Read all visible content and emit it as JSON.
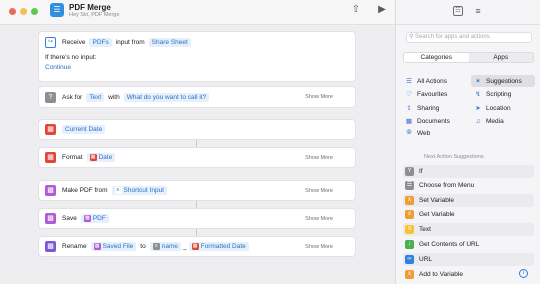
{
  "window": {
    "title": "PDF Merge",
    "subtitle": "Hey Siri, PDF Merge",
    "traffic_colors": [
      "#ed6a5e",
      "#f4bf4f",
      "#61c554"
    ]
  },
  "toolbar": {
    "share_icon": "share-icon",
    "run_icon": "play-icon"
  },
  "actions": {
    "receive": {
      "word": "Receive",
      "input_type": "PDFs",
      "input_from": "input from",
      "source": "Share Sheet",
      "no_input_label": "If there's no input:",
      "no_input_value": "Continue"
    },
    "ask": {
      "word": "Ask for",
      "type": "Text",
      "with": "with",
      "prompt": "What do you want to call it?",
      "show_more": "Show More"
    },
    "current_date": {
      "label": "Current Date"
    },
    "format": {
      "word": "Format",
      "token": "Date",
      "show_more": "Show More"
    },
    "make_pdf": {
      "word": "Make PDF from",
      "token": "Shortcut Input",
      "show_more": "Show More"
    },
    "save": {
      "word": "Save",
      "token": "PDF",
      "show_more": "Show More"
    },
    "rename": {
      "word": "Rename",
      "token1": "Saved File",
      "to": "to",
      "token2": "name",
      "sep": "_",
      "token3": "Formatted Date",
      "show_more": "Show More"
    }
  },
  "sidebar": {
    "search_placeholder": "Search for apps and actions",
    "segments": [
      "Categories",
      "Apps"
    ],
    "categories_left": [
      "All Actions",
      "Favourites",
      "Sharing",
      "Documents",
      "Web"
    ],
    "categories_right": [
      "Suggestions",
      "Scripting",
      "Location",
      "Media"
    ],
    "next_title": "Next Action Suggestions",
    "suggestions": [
      "If",
      "Choose from Menu",
      "Set Variable",
      "Get Variable",
      "Text",
      "Get Contents of URL",
      "URL",
      "Add to Variable"
    ]
  }
}
